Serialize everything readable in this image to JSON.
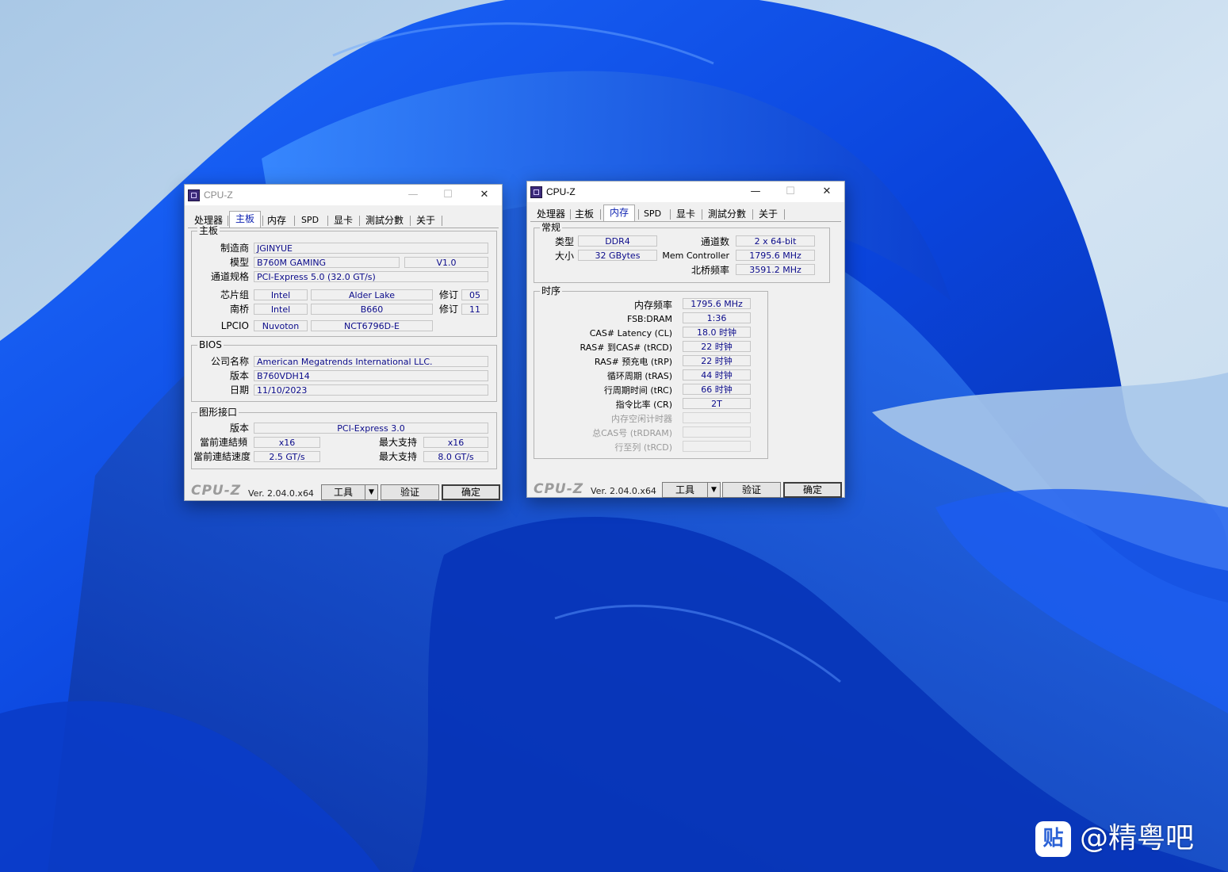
{
  "windows": {
    "mainboard": {
      "title": "CPU-Z",
      "minimize": "—",
      "maximize": "☐",
      "close": "✕",
      "tabs": [
        "处理器",
        "主板",
        "内存",
        "SPD",
        "显卡",
        "測試分數",
        "关于"
      ],
      "active_tab": "主板",
      "motherboard": {
        "group_title": "主板",
        "manufacturer_label": "制造商",
        "manufacturer": "JGINYUE",
        "model_label": "模型",
        "model": "B760M GAMING",
        "model_rev": "V1.0",
        "bus_label": "通道规格",
        "bus": "PCI-Express 5.0 (32.0 GT/s)",
        "chipset_label": "芯片组",
        "chipset_vendor": "Intel",
        "chipset_name": "Alder Lake",
        "rev_label": "修订",
        "chipset_rev": "05",
        "southbridge_label": "南桥",
        "southbridge_vendor": "Intel",
        "southbridge_name": "B660",
        "southbridge_rev": "11",
        "lpcio_label": "LPCIO",
        "lpcio_vendor": "Nuvoton",
        "lpcio_name": "NCT6796D-E"
      },
      "bios": {
        "group_title": "BIOS",
        "brand_label": "公司名称",
        "brand": "American Megatrends International LLC.",
        "version_label": "版本",
        "version": "B760VDH14",
        "date_label": "日期",
        "date": "11/10/2023"
      },
      "graphic_interface": {
        "group_title": "图形接口",
        "version_label": "版本",
        "version": "PCI-Express 3.0",
        "link_width_label": "當前連結頻",
        "link_width": "x16",
        "max_label": "最大支持",
        "max_width": "x16",
        "link_speed_label": "當前連結速度",
        "link_speed": "2.5 GT/s",
        "max_speed": "8.0 GT/s"
      },
      "footer": {
        "logo": "CPU-Z",
        "version": "Ver. 2.04.0.x64",
        "tools": "工具",
        "validate": "验证",
        "ok": "确定"
      }
    },
    "memory": {
      "title": "CPU-Z",
      "minimize": "—",
      "maximize": "☐",
      "close": "✕",
      "tabs": [
        "处理器",
        "主板",
        "内存",
        "SPD",
        "显卡",
        "測試分數",
        "关于"
      ],
      "active_tab": "内存",
      "general": {
        "group_title": "常规",
        "type_label": "类型",
        "type": "DDR4",
        "size_label": "大小",
        "size": "32 GBytes",
        "channels_label": "通道数",
        "channels": "2 x 64-bit",
        "mem_controller_label": "Mem Controller",
        "mem_controller": "1795.6 MHz",
        "nb_freq_label": "北桥频率",
        "nb_freq": "3591.2 MHz"
      },
      "timings": {
        "group_title": "时序",
        "dram_freq_label": "内存频率",
        "dram_freq": "1795.6 MHz",
        "fsb_dram_label": "FSB:DRAM",
        "fsb_dram": "1:36",
        "cas_label": "CAS# Latency (CL)",
        "cas": "18.0 时钟",
        "trcd_label": "RAS# 到CAS# (tRCD)",
        "trcd": "22 时钟",
        "trp_label": "RAS# 预充电 (tRP)",
        "trp": "22 时钟",
        "tras_label": "循环周期 (tRAS)",
        "tras": "44 时钟",
        "trc_label": "行周期时间 (tRC)",
        "trc": "66 时钟",
        "cr_label": "指令比率 (CR)",
        "cr": "2T",
        "idle_timer_label": "内存空闲计时器",
        "trdram_label": "总CAS号 (tRDRAM)",
        "row_to_col_label": "行至列 (tRCD)"
      },
      "footer": {
        "logo": "CPU-Z",
        "version": "Ver. 2.04.0.x64",
        "tools": "工具",
        "validate": "验证",
        "ok": "确定"
      }
    }
  },
  "watermark": {
    "icon_text": "贴",
    "text": "@精粤吧"
  },
  "colors": {
    "desktop_bg": "#c6dcee",
    "ribbon_blue": "#0a47e0",
    "value_text": "#0b0b8a",
    "active_tab_text": "#0a1fb0"
  }
}
